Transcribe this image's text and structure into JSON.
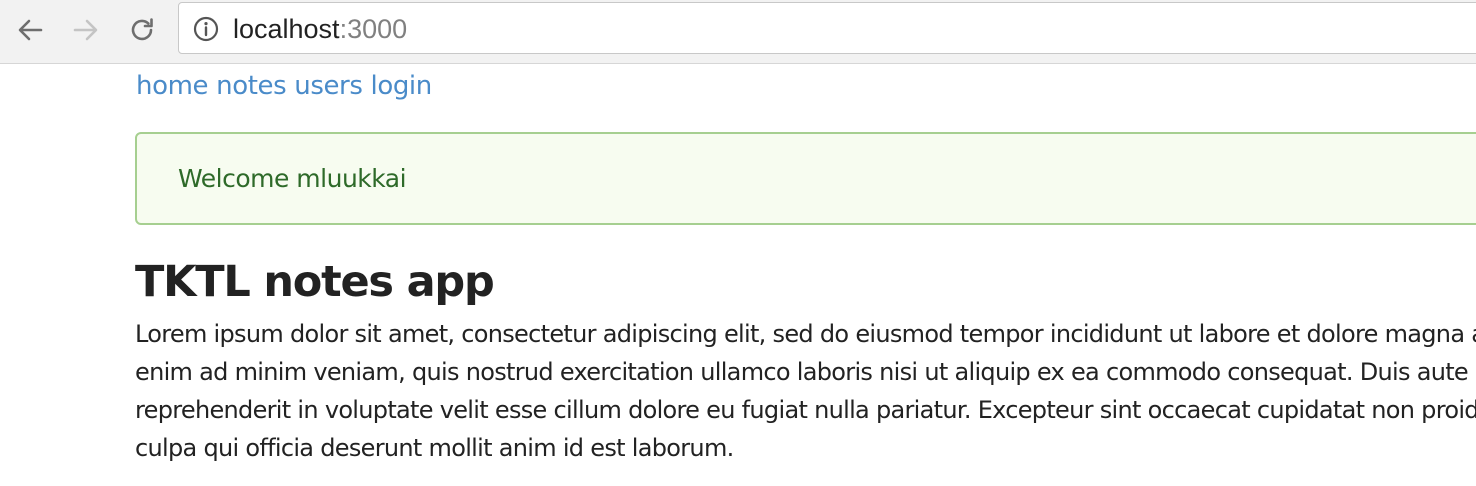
{
  "browser": {
    "url_host": "localhost",
    "url_port": ":3000"
  },
  "nav": {
    "items": [
      {
        "label": "home"
      },
      {
        "label": "notes"
      },
      {
        "label": "users"
      },
      {
        "label": "login"
      }
    ]
  },
  "notification": {
    "message": "Welcome mluukkai"
  },
  "main": {
    "title": "TKTL notes app",
    "body": "Lorem ipsum dolor sit amet, consectetur adipiscing elit, sed do eiusmod tempor incididunt ut labore et dolore magna aliqua. Ut enim ad minim veniam, quis nostrud exercitation ullamco laboris nisi ut aliquip ex ea commodo consequat. Duis aute irure dolor in reprehenderit in voluptate velit esse cillum dolore eu fugiat nulla pariatur. Excepteur sint occaecat cupidatat non proident, sunt in culpa qui officia deserunt mollit anim id est laborum."
  },
  "colors": {
    "link": "#4a8bc9",
    "notification_text": "#2e6a29",
    "notification_border": "#a6cf90",
    "notification_bg": "#f7fcf0"
  }
}
